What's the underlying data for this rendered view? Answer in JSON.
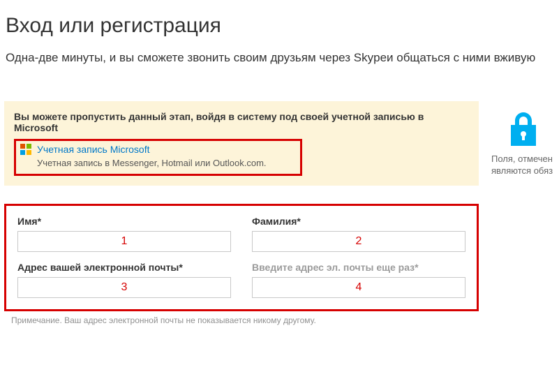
{
  "header": {
    "title": "Вход или регистрация",
    "subtitle": "Одна-две минуты, и вы сможете звонить своим друзьям через Skypeи общаться с ними вживую"
  },
  "notice": {
    "title": "Вы можете пропустить данный этап, войдя в систему под своей учетной записью в Microsoft",
    "ms_link": "Учетная запись Microsoft",
    "ms_sub": "Учетная запись в Messenger, Hotmail или Outlook.com."
  },
  "form": {
    "first_name_label": "Имя*",
    "last_name_label": "Фамилия*",
    "email_label": "Адрес вашей электронной почты*",
    "email_confirm_label": "Введите адрес эл. почты еще раз*",
    "note": "Примечание. Ваш адрес электронной почты не показывается никому другому."
  },
  "annotations": {
    "a1": "1",
    "a2": "2",
    "a3": "3",
    "a4": "4"
  },
  "side": {
    "text1": "Поля, отмечен",
    "text2": "являются обяз"
  },
  "colors": {
    "accent_blue": "#00aff0",
    "link_blue": "#0078c8",
    "danger": "#d60000",
    "notice_bg": "#fdf4d9"
  }
}
